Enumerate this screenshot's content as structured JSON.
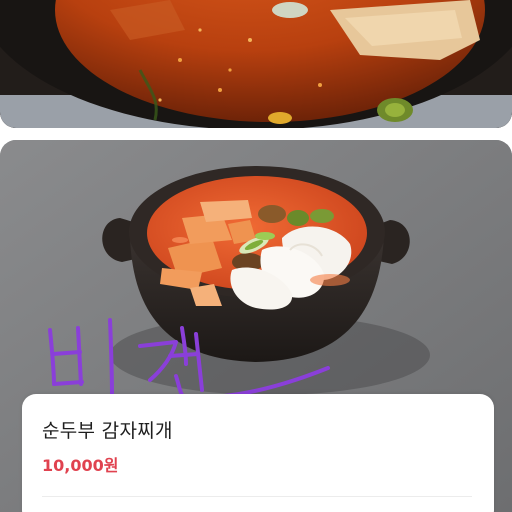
{
  "menu_item": {
    "name": "순두부 감자찌개",
    "price": "10,000원",
    "price_color": "#e0424f"
  },
  "overlay": {
    "handwritten_text": "비건"
  },
  "icons": {
    "top_photo": "stew-photo",
    "main_photo": "soft-tofu-potato-stew-photo"
  }
}
